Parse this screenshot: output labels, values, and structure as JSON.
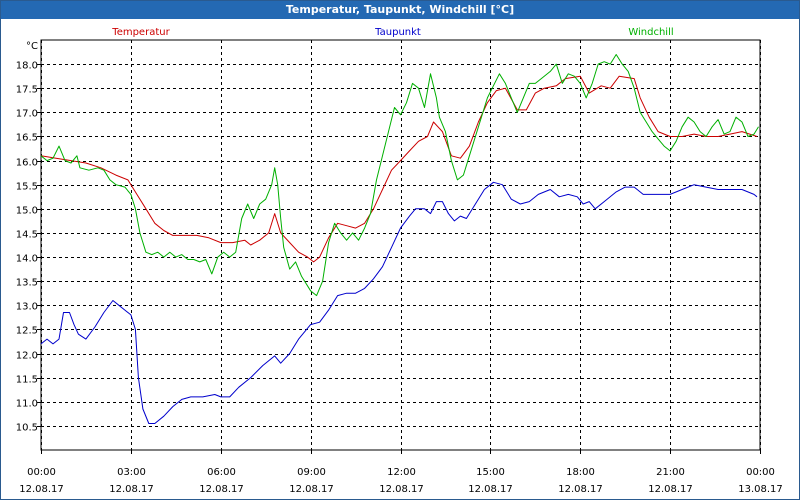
{
  "window": {
    "title": "Temperatur, Taupunkt, Windchill [°C]"
  },
  "chart_data": {
    "type": "line",
    "title": "Temperatur, Taupunkt, Windchill [°C]",
    "ylabel": "°C",
    "ylim": [
      10.0,
      18.5
    ],
    "yticks": [
      10.5,
      11.0,
      11.5,
      12.0,
      12.5,
      13.0,
      13.5,
      14.0,
      14.5,
      15.0,
      15.5,
      16.0,
      16.5,
      17.0,
      17.5,
      18.0
    ],
    "xlim": [
      0,
      24
    ],
    "xticks": [
      {
        "h": 0,
        "time": "00:00",
        "date": "12.08.17"
      },
      {
        "h": 3,
        "time": "03:00",
        "date": "12.08.17"
      },
      {
        "h": 6,
        "time": "06:00",
        "date": "12.08.17"
      },
      {
        "h": 9,
        "time": "09:00",
        "date": "12.08.17"
      },
      {
        "h": 12,
        "time": "12:00",
        "date": "12.08.17"
      },
      {
        "h": 15,
        "time": "15:00",
        "date": "12.08.17"
      },
      {
        "h": 18,
        "time": "18:00",
        "date": "12.08.17"
      },
      {
        "h": 21,
        "time": "21:00",
        "date": "12.08.17"
      },
      {
        "h": 24,
        "time": "00:00",
        "date": "13.08.17"
      }
    ],
    "grid": true,
    "legend_position": "top",
    "series": [
      {
        "name": "Temperatur",
        "color": "#cc0000",
        "points": [
          [
            0,
            16.1
          ],
          [
            0.5,
            16.05
          ],
          [
            1,
            16.0
          ],
          [
            1.5,
            15.95
          ],
          [
            2,
            15.85
          ],
          [
            2.5,
            15.7
          ],
          [
            2.9,
            15.6
          ],
          [
            3.2,
            15.3
          ],
          [
            3.5,
            15.0
          ],
          [
            3.8,
            14.7
          ],
          [
            4.1,
            14.55
          ],
          [
            4.4,
            14.45
          ],
          [
            4.8,
            14.45
          ],
          [
            5.2,
            14.45
          ],
          [
            5.6,
            14.4
          ],
          [
            6.0,
            14.3
          ],
          [
            6.4,
            14.3
          ],
          [
            6.8,
            14.35
          ],
          [
            7.0,
            14.25
          ],
          [
            7.3,
            14.35
          ],
          [
            7.6,
            14.5
          ],
          [
            7.8,
            14.9
          ],
          [
            8.0,
            14.5
          ],
          [
            8.3,
            14.3
          ],
          [
            8.6,
            14.1
          ],
          [
            8.9,
            14.0
          ],
          [
            9.1,
            13.9
          ],
          [
            9.3,
            14.0
          ],
          [
            9.6,
            14.4
          ],
          [
            9.9,
            14.7
          ],
          [
            10.2,
            14.65
          ],
          [
            10.5,
            14.6
          ],
          [
            10.8,
            14.7
          ],
          [
            11.1,
            15.0
          ],
          [
            11.4,
            15.4
          ],
          [
            11.7,
            15.8
          ],
          [
            12.0,
            16.0
          ],
          [
            12.3,
            16.2
          ],
          [
            12.6,
            16.4
          ],
          [
            12.9,
            16.5
          ],
          [
            13.1,
            16.8
          ],
          [
            13.4,
            16.6
          ],
          [
            13.7,
            16.1
          ],
          [
            14.0,
            16.05
          ],
          [
            14.3,
            16.3
          ],
          [
            14.6,
            16.8
          ],
          [
            14.9,
            17.2
          ],
          [
            15.2,
            17.45
          ],
          [
            15.5,
            17.5
          ],
          [
            15.9,
            17.05
          ],
          [
            16.2,
            17.05
          ],
          [
            16.5,
            17.4
          ],
          [
            16.8,
            17.5
          ],
          [
            17.2,
            17.55
          ],
          [
            17.5,
            17.7
          ],
          [
            18.0,
            17.75
          ],
          [
            18.3,
            17.4
          ],
          [
            18.7,
            17.55
          ],
          [
            19.0,
            17.5
          ],
          [
            19.3,
            17.75
          ],
          [
            19.8,
            17.7
          ],
          [
            20.0,
            17.3
          ],
          [
            20.3,
            16.9
          ],
          [
            20.6,
            16.6
          ],
          [
            21.0,
            16.5
          ],
          [
            21.4,
            16.5
          ],
          [
            21.8,
            16.55
          ],
          [
            22.2,
            16.5
          ],
          [
            22.6,
            16.5
          ],
          [
            23.0,
            16.55
          ],
          [
            23.4,
            16.6
          ],
          [
            23.9,
            16.5
          ]
        ]
      },
      {
        "name": "Taupunkt",
        "color": "#0000cc",
        "points": [
          [
            0,
            12.2
          ],
          [
            0.2,
            12.3
          ],
          [
            0.4,
            12.2
          ],
          [
            0.6,
            12.3
          ],
          [
            0.75,
            12.85
          ],
          [
            0.95,
            12.85
          ],
          [
            1.1,
            12.6
          ],
          [
            1.25,
            12.4
          ],
          [
            1.5,
            12.3
          ],
          [
            1.8,
            12.55
          ],
          [
            2.1,
            12.85
          ],
          [
            2.4,
            13.1
          ],
          [
            2.6,
            13.0
          ],
          [
            2.8,
            12.9
          ],
          [
            3.0,
            12.8
          ],
          [
            3.15,
            12.5
          ],
          [
            3.25,
            11.5
          ],
          [
            3.4,
            10.85
          ],
          [
            3.6,
            10.55
          ],
          [
            3.8,
            10.55
          ],
          [
            4.1,
            10.7
          ],
          [
            4.4,
            10.9
          ],
          [
            4.7,
            11.05
          ],
          [
            5.0,
            11.1
          ],
          [
            5.4,
            11.1
          ],
          [
            5.8,
            11.15
          ],
          [
            6.0,
            11.1
          ],
          [
            6.3,
            11.1
          ],
          [
            6.6,
            11.3
          ],
          [
            7.0,
            11.5
          ],
          [
            7.4,
            11.75
          ],
          [
            7.8,
            11.95
          ],
          [
            8.0,
            11.8
          ],
          [
            8.3,
            12.0
          ],
          [
            8.6,
            12.3
          ],
          [
            9.0,
            12.6
          ],
          [
            9.3,
            12.65
          ],
          [
            9.6,
            12.9
          ],
          [
            9.9,
            13.2
          ],
          [
            10.2,
            13.25
          ],
          [
            10.5,
            13.25
          ],
          [
            10.8,
            13.35
          ],
          [
            11.1,
            13.55
          ],
          [
            11.4,
            13.8
          ],
          [
            11.7,
            14.2
          ],
          [
            12.0,
            14.6
          ],
          [
            12.3,
            14.85
          ],
          [
            12.5,
            15.0
          ],
          [
            12.8,
            15.0
          ],
          [
            13.0,
            14.9
          ],
          [
            13.2,
            15.15
          ],
          [
            13.4,
            15.15
          ],
          [
            13.6,
            14.9
          ],
          [
            13.8,
            14.75
          ],
          [
            14.0,
            14.85
          ],
          [
            14.2,
            14.8
          ],
          [
            14.5,
            15.1
          ],
          [
            14.8,
            15.4
          ],
          [
            15.1,
            15.55
          ],
          [
            15.4,
            15.5
          ],
          [
            15.7,
            15.2
          ],
          [
            16.0,
            15.1
          ],
          [
            16.3,
            15.15
          ],
          [
            16.6,
            15.3
          ],
          [
            17.0,
            15.4
          ],
          [
            17.3,
            15.25
          ],
          [
            17.6,
            15.3
          ],
          [
            17.9,
            15.25
          ],
          [
            18.1,
            15.1
          ],
          [
            18.3,
            15.15
          ],
          [
            18.5,
            15.0
          ],
          [
            18.8,
            15.15
          ],
          [
            19.2,
            15.35
          ],
          [
            19.5,
            15.45
          ],
          [
            19.8,
            15.45
          ],
          [
            20.1,
            15.3
          ],
          [
            20.5,
            15.3
          ],
          [
            21.0,
            15.3
          ],
          [
            21.4,
            15.4
          ],
          [
            21.8,
            15.5
          ],
          [
            22.2,
            15.45
          ],
          [
            22.6,
            15.4
          ],
          [
            23.0,
            15.4
          ],
          [
            23.4,
            15.4
          ],
          [
            23.8,
            15.3
          ],
          [
            23.9,
            15.25
          ]
        ]
      },
      {
        "name": "Windchill",
        "color": "#00b000",
        "points": [
          [
            0,
            16.1
          ],
          [
            0.2,
            16.0
          ],
          [
            0.4,
            16.05
          ],
          [
            0.6,
            16.3
          ],
          [
            0.8,
            16.0
          ],
          [
            1.0,
            15.95
          ],
          [
            1.2,
            16.1
          ],
          [
            1.3,
            15.85
          ],
          [
            1.6,
            15.8
          ],
          [
            1.9,
            15.85
          ],
          [
            2.1,
            15.8
          ],
          [
            2.3,
            15.6
          ],
          [
            2.5,
            15.5
          ],
          [
            2.8,
            15.45
          ],
          [
            3.0,
            15.3
          ],
          [
            3.15,
            15.0
          ],
          [
            3.3,
            14.5
          ],
          [
            3.5,
            14.1
          ],
          [
            3.7,
            14.05
          ],
          [
            3.9,
            14.1
          ],
          [
            4.1,
            14.0
          ],
          [
            4.3,
            14.1
          ],
          [
            4.5,
            14.0
          ],
          [
            4.7,
            14.05
          ],
          [
            4.9,
            13.95
          ],
          [
            5.1,
            13.95
          ],
          [
            5.3,
            13.9
          ],
          [
            5.5,
            13.95
          ],
          [
            5.7,
            13.65
          ],
          [
            5.9,
            14.0
          ],
          [
            6.1,
            14.1
          ],
          [
            6.3,
            14.0
          ],
          [
            6.5,
            14.1
          ],
          [
            6.7,
            14.8
          ],
          [
            6.9,
            15.1
          ],
          [
            7.1,
            14.8
          ],
          [
            7.3,
            15.1
          ],
          [
            7.5,
            15.2
          ],
          [
            7.7,
            15.5
          ],
          [
            7.8,
            15.85
          ],
          [
            7.9,
            15.5
          ],
          [
            8.0,
            14.8
          ],
          [
            8.1,
            14.2
          ],
          [
            8.3,
            13.75
          ],
          [
            8.5,
            13.9
          ],
          [
            8.7,
            13.6
          ],
          [
            9.0,
            13.3
          ],
          [
            9.2,
            13.2
          ],
          [
            9.4,
            13.5
          ],
          [
            9.6,
            14.3
          ],
          [
            9.8,
            14.7
          ],
          [
            10.0,
            14.5
          ],
          [
            10.2,
            14.35
          ],
          [
            10.4,
            14.5
          ],
          [
            10.6,
            14.35
          ],
          [
            10.8,
            14.6
          ],
          [
            11.0,
            14.9
          ],
          [
            11.2,
            15.6
          ],
          [
            11.4,
            16.1
          ],
          [
            11.6,
            16.6
          ],
          [
            11.8,
            17.1
          ],
          [
            12.0,
            16.95
          ],
          [
            12.2,
            17.2
          ],
          [
            12.4,
            17.6
          ],
          [
            12.6,
            17.5
          ],
          [
            12.8,
            17.1
          ],
          [
            13.0,
            17.8
          ],
          [
            13.2,
            17.3
          ],
          [
            13.3,
            16.9
          ],
          [
            13.5,
            16.6
          ],
          [
            13.7,
            16.0
          ],
          [
            13.9,
            15.6
          ],
          [
            14.1,
            15.7
          ],
          [
            14.3,
            16.1
          ],
          [
            14.5,
            16.5
          ],
          [
            14.7,
            16.9
          ],
          [
            14.9,
            17.3
          ],
          [
            15.1,
            17.55
          ],
          [
            15.3,
            17.8
          ],
          [
            15.5,
            17.6
          ],
          [
            15.7,
            17.3
          ],
          [
            15.9,
            17.0
          ],
          [
            16.1,
            17.3
          ],
          [
            16.3,
            17.6
          ],
          [
            16.5,
            17.6
          ],
          [
            16.7,
            17.7
          ],
          [
            17.0,
            17.85
          ],
          [
            17.2,
            18.0
          ],
          [
            17.4,
            17.6
          ],
          [
            17.6,
            17.8
          ],
          [
            17.8,
            17.75
          ],
          [
            18.0,
            17.6
          ],
          [
            18.2,
            17.3
          ],
          [
            18.4,
            17.6
          ],
          [
            18.6,
            18.0
          ],
          [
            18.8,
            18.05
          ],
          [
            19.0,
            18.0
          ],
          [
            19.2,
            18.2
          ],
          [
            19.4,
            18.0
          ],
          [
            19.6,
            17.85
          ],
          [
            19.8,
            17.5
          ],
          [
            20.0,
            17.0
          ],
          [
            20.2,
            16.8
          ],
          [
            20.4,
            16.6
          ],
          [
            20.6,
            16.45
          ],
          [
            20.8,
            16.3
          ],
          [
            21.0,
            16.2
          ],
          [
            21.2,
            16.4
          ],
          [
            21.4,
            16.7
          ],
          [
            21.6,
            16.9
          ],
          [
            21.8,
            16.8
          ],
          [
            22.0,
            16.6
          ],
          [
            22.2,
            16.5
          ],
          [
            22.4,
            16.7
          ],
          [
            22.6,
            16.85
          ],
          [
            22.8,
            16.55
          ],
          [
            23.0,
            16.6
          ],
          [
            23.2,
            16.9
          ],
          [
            23.4,
            16.8
          ],
          [
            23.6,
            16.5
          ],
          [
            23.8,
            16.55
          ],
          [
            23.95,
            16.7
          ]
        ]
      }
    ]
  }
}
